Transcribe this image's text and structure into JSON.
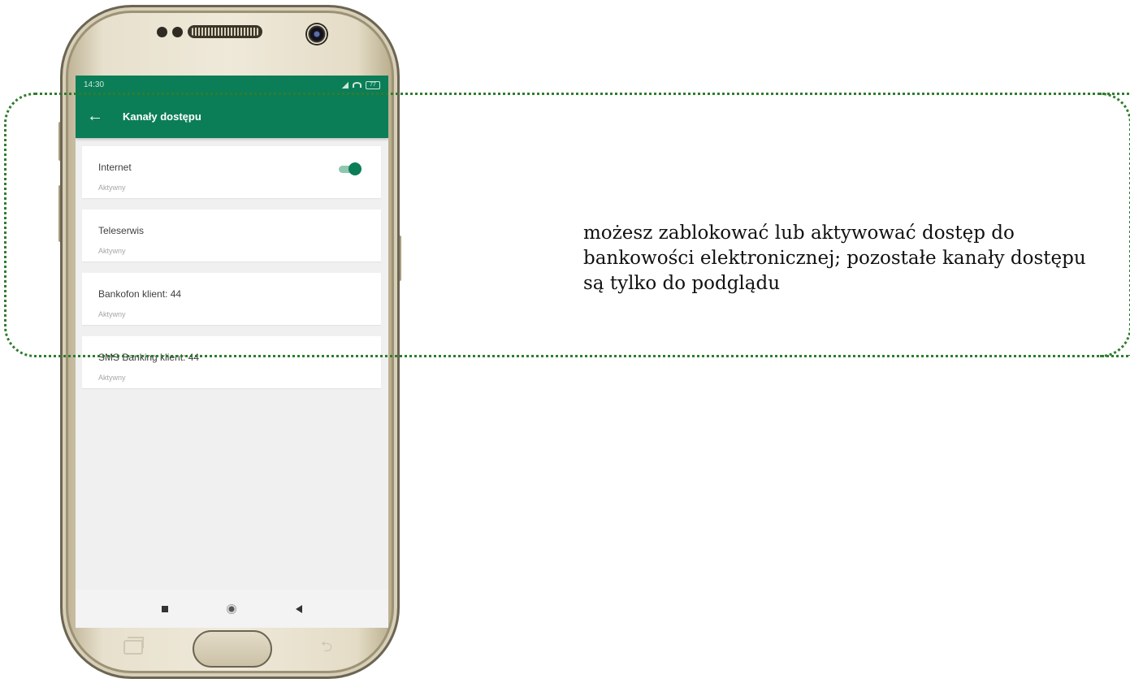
{
  "status_bar": {
    "time": "14:30",
    "battery": "77"
  },
  "app_bar": {
    "back_icon": "arrow-left-icon",
    "title": "Kanały dostępu"
  },
  "channels": [
    {
      "name": "Internet",
      "status": "Aktywny",
      "toggle": "on"
    },
    {
      "name": "Teleserwis",
      "status": "Aktywny"
    },
    {
      "name": "Bankofon klient: 44",
      "status": "Aktywny"
    },
    {
      "name": "SMS Banking klient: 44",
      "status": "Aktywny"
    }
  ],
  "callout": {
    "text": "możesz zablokować lub aktywować dostęp do bankowości elektronicznej; pozostałe kanały dostępu są tylko do podglądu"
  },
  "colors": {
    "brand_green": "#0b7e58",
    "callout_border": "#2f7d2f"
  }
}
